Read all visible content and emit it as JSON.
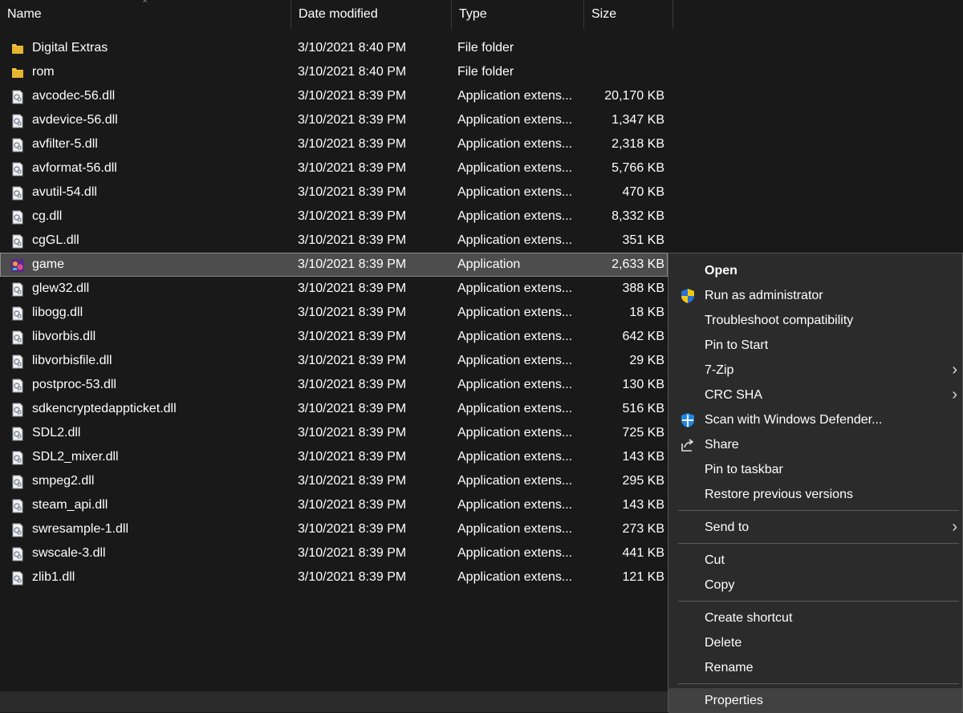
{
  "columns": {
    "name": "Name",
    "date": "Date modified",
    "type": "Type",
    "size": "Size"
  },
  "files": [
    {
      "name": "Digital Extras",
      "date": "3/10/2021 8:40 PM",
      "type": "File folder",
      "size": "",
      "icon": "folder-icon"
    },
    {
      "name": "rom",
      "date": "3/10/2021 8:40 PM",
      "type": "File folder",
      "size": "",
      "icon": "folder-icon"
    },
    {
      "name": "avcodec-56.dll",
      "date": "3/10/2021 8:39 PM",
      "type": "Application extens...",
      "size": "20,170 KB",
      "icon": "dll-file-icon"
    },
    {
      "name": "avdevice-56.dll",
      "date": "3/10/2021 8:39 PM",
      "type": "Application extens...",
      "size": "1,347 KB",
      "icon": "dll-file-icon"
    },
    {
      "name": "avfilter-5.dll",
      "date": "3/10/2021 8:39 PM",
      "type": "Application extens...",
      "size": "2,318 KB",
      "icon": "dll-file-icon"
    },
    {
      "name": "avformat-56.dll",
      "date": "3/10/2021 8:39 PM",
      "type": "Application extens...",
      "size": "5,766 KB",
      "icon": "dll-file-icon"
    },
    {
      "name": "avutil-54.dll",
      "date": "3/10/2021 8:39 PM",
      "type": "Application extens...",
      "size": "470 KB",
      "icon": "dll-file-icon"
    },
    {
      "name": "cg.dll",
      "date": "3/10/2021 8:39 PM",
      "type": "Application extens...",
      "size": "8,332 KB",
      "icon": "dll-file-icon"
    },
    {
      "name": "cgGL.dll",
      "date": "3/10/2021 8:39 PM",
      "type": "Application extens...",
      "size": "351 KB",
      "icon": "dll-file-icon"
    },
    {
      "name": "game",
      "date": "3/10/2021 8:39 PM",
      "type": "Application",
      "size": "2,633 KB",
      "icon": "game-app-icon",
      "selected": true
    },
    {
      "name": "glew32.dll",
      "date": "3/10/2021 8:39 PM",
      "type": "Application extens...",
      "size": "388 KB",
      "icon": "dll-file-icon"
    },
    {
      "name": "libogg.dll",
      "date": "3/10/2021 8:39 PM",
      "type": "Application extens...",
      "size": "18 KB",
      "icon": "dll-file-icon"
    },
    {
      "name": "libvorbis.dll",
      "date": "3/10/2021 8:39 PM",
      "type": "Application extens...",
      "size": "642 KB",
      "icon": "dll-file-icon"
    },
    {
      "name": "libvorbisfile.dll",
      "date": "3/10/2021 8:39 PM",
      "type": "Application extens...",
      "size": "29 KB",
      "icon": "dll-file-icon"
    },
    {
      "name": "postproc-53.dll",
      "date": "3/10/2021 8:39 PM",
      "type": "Application extens...",
      "size": "130 KB",
      "icon": "dll-file-icon"
    },
    {
      "name": "sdkencryptedappticket.dll",
      "date": "3/10/2021 8:39 PM",
      "type": "Application extens...",
      "size": "516 KB",
      "icon": "dll-file-icon"
    },
    {
      "name": "SDL2.dll",
      "date": "3/10/2021 8:39 PM",
      "type": "Application extens...",
      "size": "725 KB",
      "icon": "dll-file-icon"
    },
    {
      "name": "SDL2_mixer.dll",
      "date": "3/10/2021 8:39 PM",
      "type": "Application extens...",
      "size": "143 KB",
      "icon": "dll-file-icon"
    },
    {
      "name": "smpeg2.dll",
      "date": "3/10/2021 8:39 PM",
      "type": "Application extens...",
      "size": "295 KB",
      "icon": "dll-file-icon"
    },
    {
      "name": "steam_api.dll",
      "date": "3/10/2021 8:39 PM",
      "type": "Application extens...",
      "size": "143 KB",
      "icon": "dll-file-icon"
    },
    {
      "name": "swresample-1.dll",
      "date": "3/10/2021 8:39 PM",
      "type": "Application extens...",
      "size": "273 KB",
      "icon": "dll-file-icon"
    },
    {
      "name": "swscale-3.dll",
      "date": "3/10/2021 8:39 PM",
      "type": "Application extens...",
      "size": "441 KB",
      "icon": "dll-file-icon"
    },
    {
      "name": "zlib1.dll",
      "date": "3/10/2021 8:39 PM",
      "type": "Application extens...",
      "size": "121 KB",
      "icon": "dll-file-icon"
    }
  ],
  "context_menu": {
    "open": "Open",
    "run_as_admin": "Run as administrator",
    "troubleshoot": "Troubleshoot compatibility",
    "pin_start": "Pin to Start",
    "seven_zip": "7-Zip",
    "crc_sha": "CRC SHA",
    "defender": "Scan with Windows Defender...",
    "share": "Share",
    "pin_taskbar": "Pin to taskbar",
    "restore": "Restore previous versions",
    "send_to": "Send to",
    "cut": "Cut",
    "copy": "Copy",
    "create_shortcut": "Create shortcut",
    "delete": "Delete",
    "rename": "Rename",
    "properties": "Properties"
  },
  "colors": {
    "background": "#191919",
    "menu_background": "#2b2b2b",
    "selection": "#4d4d4d",
    "folder": "#f4c542"
  }
}
